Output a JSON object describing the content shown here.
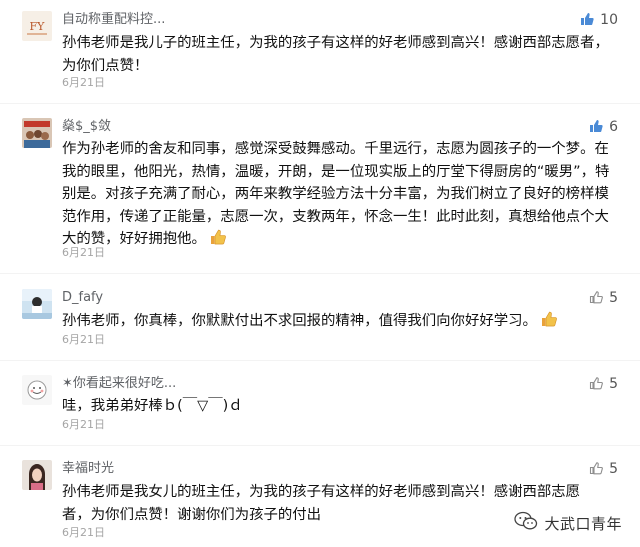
{
  "comments": [
    {
      "nickname": "自动称重配料控...",
      "likes": "10",
      "liked": true,
      "text": "孙伟老师是我儿子的班主任，为我的孩子有这样的好老师感到高兴！感谢西部志愿者，为你们点赞！",
      "date": "6月21日",
      "avatar_text": "FY"
    },
    {
      "nickname": "燊$_$敛",
      "likes": "6",
      "liked": true,
      "text": "作为孙老师的舍友和同事，感觉深受鼓舞感动。千里远行，志愿为圆孩子的一个梦。在我的眼里，他阳光，热情，温暖，开朗，是一位现实版上的厅堂下得厨房的“暖男”，特别是。对孩子充满了耐心，两年来教学经验方法十分丰富，为我们树立了良好的榜样模范作用，传递了正能量，志愿一次，支教两年，怀念一生！此时此刻，真想给他点个大大的赞，好好拥抱他。",
      "date": "6月21日"
    },
    {
      "nickname": "D_fafy",
      "likes": "5",
      "liked": false,
      "text": "孙伟老师，你真棒，你默默付出不求回报的精神，值得我们向你好好学习。",
      "date": "6月21日"
    },
    {
      "nickname": "✶你看起来很好吃...",
      "likes": "5",
      "liked": false,
      "text": "哇，我弟弟好棒ｂ(￣▽￣)ｄ",
      "date": "6月21日"
    },
    {
      "nickname": "幸福时光",
      "likes": "5",
      "liked": false,
      "text": "孙伟老师是我女儿的班主任，为我的孩子有这样的好老师感到高兴！感谢西部志愿者，为你们点赞！谢谢你们为孩子的付出",
      "date": "6月21日"
    }
  ],
  "watermark": {
    "text": "大武口青年",
    "icon": "wechat-icon"
  },
  "colors": {
    "like_active": "#4a8ad6",
    "like_inactive": "#8e8e8e",
    "nickname": "#5f6266",
    "date": "#a5a5a5"
  },
  "icons": {
    "like": "thumbs-up-icon",
    "emoji": "thumbs-up-emoji-icon"
  }
}
